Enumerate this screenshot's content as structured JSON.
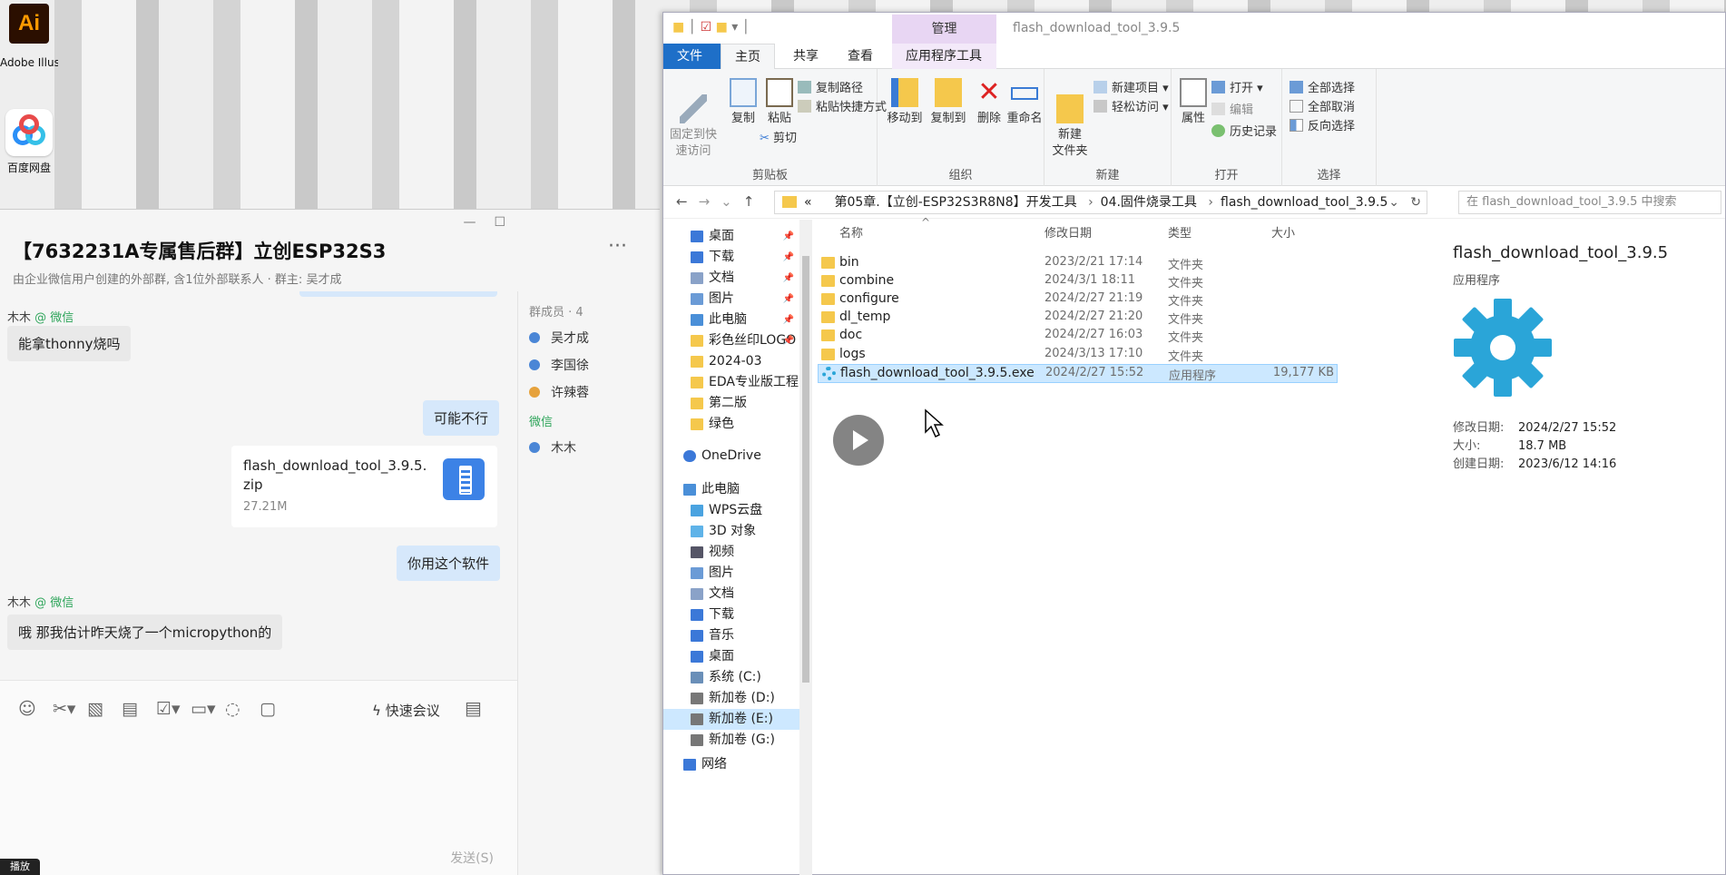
{
  "desktop": {
    "icons": [
      {
        "label": "Adobe Illustrato...",
        "glyph": "Ai"
      },
      {
        "label": "百度网盘"
      }
    ]
  },
  "chat": {
    "title": "【7632231A专属售后群】立创ESP32S3",
    "subtitle": "由企业微信用户创建的外部群, 含1位外部联系人 · 群主: 吴才成",
    "messages": [
      {
        "sender": "木木",
        "tag": "@ 微信",
        "text": "能拿thonny烧吗"
      },
      {
        "text": "可能不行"
      },
      {
        "file_name": "flash_download_tool_3.9.5.zip",
        "file_size": "27.21M"
      },
      {
        "text": "你用这个软件"
      },
      {
        "sender": "木木",
        "tag": "@ 微信",
        "text": "哦  那我估计昨天烧了一个micropython的"
      }
    ],
    "members_header": "群成员 · 4",
    "members": [
      "吴才成",
      "李国徐",
      "许辣蓉"
    ],
    "wechat_label": "微信",
    "wechat_members": [
      "木木"
    ],
    "toolbar": {
      "quick_meeting": "快速会议"
    },
    "send_label": "发送(S)",
    "bottom_tag": "播放"
  },
  "explorer": {
    "title": "flash_download_tool_3.9.5",
    "manage_tab": "管理",
    "tabs": [
      "文件",
      "主页",
      "共享",
      "查看",
      "应用程序工具"
    ],
    "ribbon": {
      "pin_quick": "固定到快\n速访问",
      "copy": "复制",
      "paste": "粘贴",
      "copy_path": "复制路径",
      "paste_shortcut": "粘贴快捷方式",
      "cut": "剪切",
      "clipboard": "剪贴板",
      "move_to": "移动到",
      "copy_to": "复制到",
      "delete": "删除",
      "rename": "重命名",
      "organize": "组织",
      "new_folder": "新建\n文件夹",
      "new_item": "新建项目 ▾",
      "easy_access": "轻松访问 ▾",
      "new": "新建",
      "properties": "属性",
      "open": "打开 ▾",
      "edit": "编辑",
      "history": "历史记录",
      "open_group": "打开",
      "select_all": "全部选择",
      "select_none": "全部取消",
      "invert": "反向选择",
      "select_group": "选择"
    },
    "address": {
      "prefix": "«",
      "parts": [
        "第05章.【立创-ESP32S3R8N8】开发工具",
        "04.固件烧录工具",
        "flash_download_tool_3.9.5"
      ]
    },
    "search_placeholder": "在 flash_download_tool_3.9.5 中搜索",
    "nav": [
      {
        "label": "桌面",
        "pin": true,
        "color": "#3b78d8"
      },
      {
        "label": "下载",
        "pin": true,
        "color": "#3b78d8"
      },
      {
        "label": "文档",
        "pin": true,
        "color": "#8aa2c8"
      },
      {
        "label": "图片",
        "pin": true,
        "color": "#6b9bd6"
      },
      {
        "label": "此电脑",
        "pin": true,
        "color": "#4a8fd8"
      },
      {
        "label": "彩色丝印LOGO",
        "pin": true,
        "color": "#f5c84c"
      },
      {
        "label": "2024-03",
        "color": "#f5c84c"
      },
      {
        "label": "EDA专业版工程",
        "color": "#f5c84c"
      },
      {
        "label": "第二版",
        "color": "#f5c84c"
      },
      {
        "label": "绿色",
        "color": "#f5c84c"
      }
    ],
    "nav_onedrive": "OneDrive",
    "nav_pc": "此电脑",
    "nav_pc_items": [
      {
        "label": "WPS云盘",
        "color": "#4aa3e0"
      },
      {
        "label": "3D 对象",
        "color": "#5fb3e8"
      },
      {
        "label": "视频",
        "color": "#556"
      },
      {
        "label": "图片",
        "color": "#6b9bd6"
      },
      {
        "label": "文档",
        "color": "#8aa2c8"
      },
      {
        "label": "下载",
        "color": "#3b78d8"
      },
      {
        "label": "音乐",
        "color": "#3b78d8"
      },
      {
        "label": "桌面",
        "color": "#3b78d8"
      },
      {
        "label": "系统 (C:)",
        "color": "#6a8fb8"
      },
      {
        "label": "新加卷 (D:)",
        "color": "#777"
      },
      {
        "label": "新加卷 (E:)",
        "color": "#777",
        "selected": true
      },
      {
        "label": "新加卷 (G:)",
        "color": "#777"
      }
    ],
    "nav_network": "网络",
    "columns": {
      "name": "名称",
      "modified": "修改日期",
      "type": "类型",
      "size": "大小"
    },
    "files": [
      {
        "name": "bin",
        "modified": "2023/2/21 17:14",
        "type": "文件夹",
        "size": ""
      },
      {
        "name": "combine",
        "modified": "2024/3/1 18:11",
        "type": "文件夹",
        "size": ""
      },
      {
        "name": "configure",
        "modified": "2024/2/27 21:19",
        "type": "文件夹",
        "size": ""
      },
      {
        "name": "dl_temp",
        "modified": "2024/2/27 21:20",
        "type": "文件夹",
        "size": ""
      },
      {
        "name": "doc",
        "modified": "2024/2/27 16:03",
        "type": "文件夹",
        "size": ""
      },
      {
        "name": "logs",
        "modified": "2024/3/13 17:10",
        "type": "文件夹",
        "size": ""
      },
      {
        "name": "flash_download_tool_3.9.5.exe",
        "modified": "2024/2/27 15:52",
        "type": "应用程序",
        "size": "19,177 KB",
        "selected": true
      }
    ],
    "details": {
      "name": "flash_download_tool_3.9.5",
      "type": "应用程序",
      "modified_label": "修改日期:",
      "modified_value": "2024/2/27 15:52",
      "size_label": "大小:",
      "size_value": "18.7 MB",
      "created_label": "创建日期:",
      "created_value": "2023/6/12 14:16"
    }
  }
}
